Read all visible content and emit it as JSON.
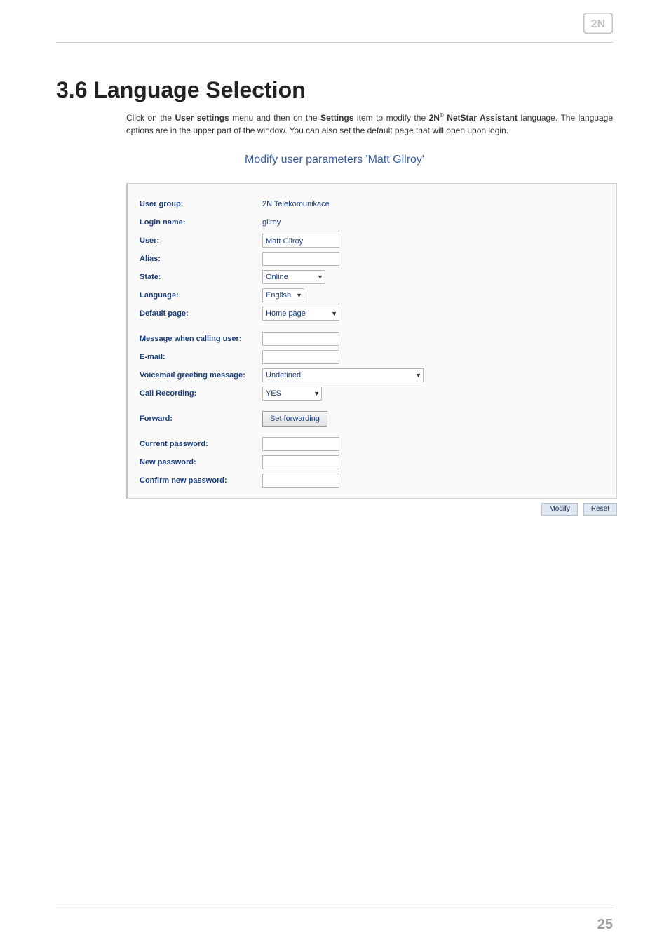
{
  "logo_text": "2N",
  "page_number": "25",
  "heading": "3.6 Language Selection",
  "intro": {
    "p1a": "Click on the ",
    "b1": "User settings",
    "p1b": " menu and then on the ",
    "b2": "Settings",
    "p1c": " item to modify the ",
    "b3": "2N",
    "sup": "®",
    "b4": " NetStar Assistant",
    "p1d": " language. The language options are in the upper part of the window. You can also set the default page that will open upon login."
  },
  "panel_title": "Modify user parameters 'Matt Gilroy'",
  "labels": {
    "user_group": "User group:",
    "login_name": "Login name:",
    "user": "User:",
    "alias": "Alias:",
    "state": "State:",
    "language": "Language:",
    "default_page": "Default page:",
    "message_when_calling": "Message when calling user:",
    "email": "E-mail:",
    "voicemail_greeting": "Voicemail greeting message:",
    "call_recording": "Call Recording:",
    "forward": "Forward:",
    "current_password": "Current password:",
    "new_password": "New password:",
    "confirm_new_password": "Confirm new password:"
  },
  "values": {
    "user_group": "2N Telekomunikace",
    "login_name": "gilroy",
    "user": "Matt Gilroy",
    "alias": "",
    "state": "Online",
    "language": "English",
    "default_page": "Home page",
    "message_when_calling": "",
    "email": "",
    "voicemail_greeting": "Undefined",
    "call_recording": "YES",
    "set_forwarding": "Set forwarding",
    "current_password": "",
    "new_password": "",
    "confirm_new_password": ""
  },
  "buttons": {
    "modify": "Modify",
    "reset": "Reset"
  }
}
